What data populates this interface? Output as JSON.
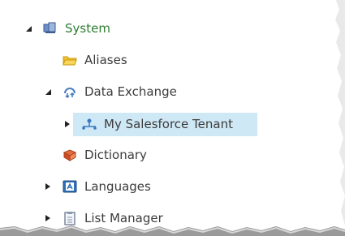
{
  "tree": {
    "items": [
      {
        "label": "System",
        "icon": "system-icon",
        "state": "expanded"
      },
      {
        "label": "Aliases",
        "icon": "folder-icon",
        "state": "leaf"
      },
      {
        "label": "Data Exchange",
        "icon": "data-exchange-icon",
        "state": "expanded"
      },
      {
        "label": "My Salesforce Tenant",
        "icon": "tenant-icon",
        "state": "collapsed",
        "selected": true
      },
      {
        "label": "Dictionary",
        "icon": "dictionary-icon",
        "state": "leaf"
      },
      {
        "label": "Languages",
        "icon": "languages-icon",
        "state": "collapsed"
      },
      {
        "label": "List Manager",
        "icon": "list-manager-icon",
        "state": "collapsed"
      }
    ]
  },
  "colors": {
    "selection": "#cfe8f5",
    "root_label": "#2e7d32",
    "text": "#3c3c3c"
  }
}
